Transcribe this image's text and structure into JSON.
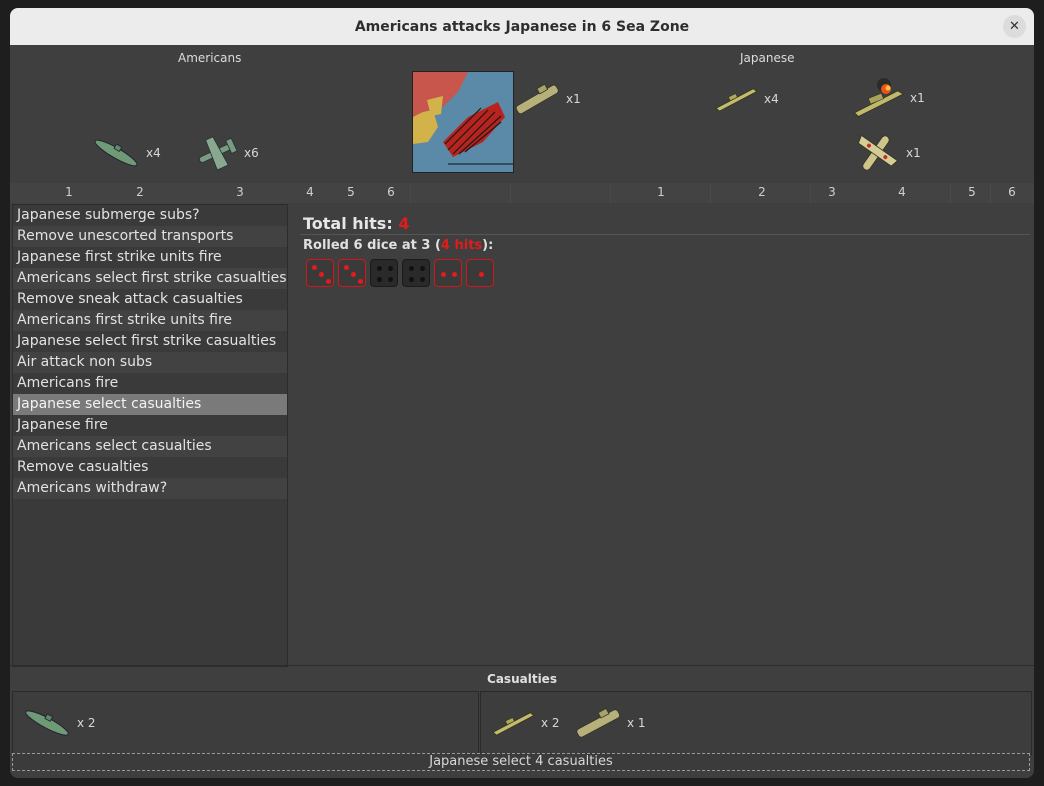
{
  "window": {
    "title": "Americans attacks Japanese in 6 Sea Zone",
    "close_icon": "close-icon"
  },
  "attacker": {
    "name": "Americans",
    "units": [
      {
        "icon": "submarine-icon",
        "count": "x4"
      },
      {
        "icon": "fighter-plane-icon",
        "count": "x6"
      }
    ]
  },
  "defender": {
    "name": "Japanese",
    "units": [
      {
        "icon": "transport-ship-icon",
        "count": "x1"
      },
      {
        "icon": "destroyer-icon",
        "count": "x4"
      },
      {
        "icon": "damaged-battleship-icon",
        "count": "x1"
      },
      {
        "icon": "fighter-plane-icon",
        "count": "x1"
      }
    ]
  },
  "ruler": {
    "left_ticks": [
      "1",
      "2",
      "3",
      "4",
      "5",
      "6"
    ],
    "right_ticks": [
      "1",
      "2",
      "3",
      "4",
      "5",
      "6"
    ]
  },
  "steps": [
    "Japanese submerge subs?",
    "Remove unescorted transports",
    "Japanese first strike units fire",
    "Americans select first strike casualties",
    "Remove sneak attack casualties",
    "Americans first strike units fire",
    "Japanese select first strike casualties",
    "Air attack non subs",
    "Americans fire",
    "Japanese select casualties",
    "Japanese fire",
    "Americans select casualties",
    "Remove casualties",
    "Americans withdraw?"
  ],
  "selected_step": 9,
  "dice_panel": {
    "total_label": "Total hits:",
    "total_value": "4",
    "rolled_prefix": "Rolled 6 dice at 3 (",
    "rolled_hits": "4 hits",
    "rolled_suffix": "):",
    "dice": [
      {
        "value": 3,
        "hit": true
      },
      {
        "value": 3,
        "hit": true
      },
      {
        "value": 4,
        "hit": false
      },
      {
        "value": 4,
        "hit": false
      },
      {
        "value": 2,
        "hit": true
      },
      {
        "value": 1,
        "hit": true
      }
    ]
  },
  "casualties": {
    "title": "Casualties",
    "left": [
      {
        "icon": "submarine-icon",
        "count": "x 2"
      }
    ],
    "right": [
      {
        "icon": "destroyer-icon",
        "count": "x 2"
      },
      {
        "icon": "transport-ship-icon",
        "count": "x 1"
      }
    ]
  },
  "status": {
    "message": "Japanese select 4 casualties"
  },
  "colors": {
    "hit": "#e01c1c",
    "panel": "#3f3f3f",
    "titlebar": "#ececec"
  }
}
